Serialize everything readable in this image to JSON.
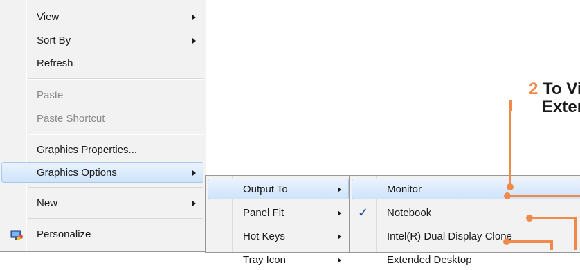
{
  "main_menu": {
    "items": [
      {
        "label": "View",
        "submenu": true,
        "disabled": false
      },
      {
        "label": "Sort By",
        "submenu": true,
        "disabled": false
      },
      {
        "label": "Refresh",
        "submenu": false,
        "disabled": false
      },
      {
        "label": "Paste",
        "submenu": false,
        "disabled": true
      },
      {
        "label": "Paste Shortcut",
        "submenu": false,
        "disabled": true
      },
      {
        "label": "Graphics Properties...",
        "submenu": false,
        "disabled": false
      },
      {
        "label": "Graphics Options",
        "submenu": true,
        "disabled": false,
        "highlighted": true
      },
      {
        "label": "New",
        "submenu": true,
        "disabled": false
      },
      {
        "label": "Personalize",
        "submenu": false,
        "disabled": false,
        "icon": "personalize-icon"
      }
    ]
  },
  "graphics_options_menu": {
    "items": [
      {
        "label": "Output To",
        "submenu": true,
        "highlighted": true
      },
      {
        "label": "Panel Fit",
        "submenu": true
      },
      {
        "label": "Hot Keys",
        "submenu": true
      },
      {
        "label": "Tray Icon",
        "submenu": true
      }
    ]
  },
  "output_to_menu": {
    "items": [
      {
        "label": "Monitor",
        "submenu": false,
        "highlighted": true,
        "checked": false
      },
      {
        "label": "Notebook",
        "submenu": false,
        "checked": true
      },
      {
        "label": "Intel(R) Dual Display Clone",
        "submenu": true,
        "checked": false
      },
      {
        "label": "Extended Desktop",
        "submenu": false,
        "checked": false
      }
    ]
  },
  "callout": {
    "number": "2",
    "line1": "To Vie",
    "line2": "Exter"
  },
  "colors": {
    "accent": "#f08a4b",
    "highlight": "#cfe3fb",
    "check": "#1b4f9c"
  }
}
